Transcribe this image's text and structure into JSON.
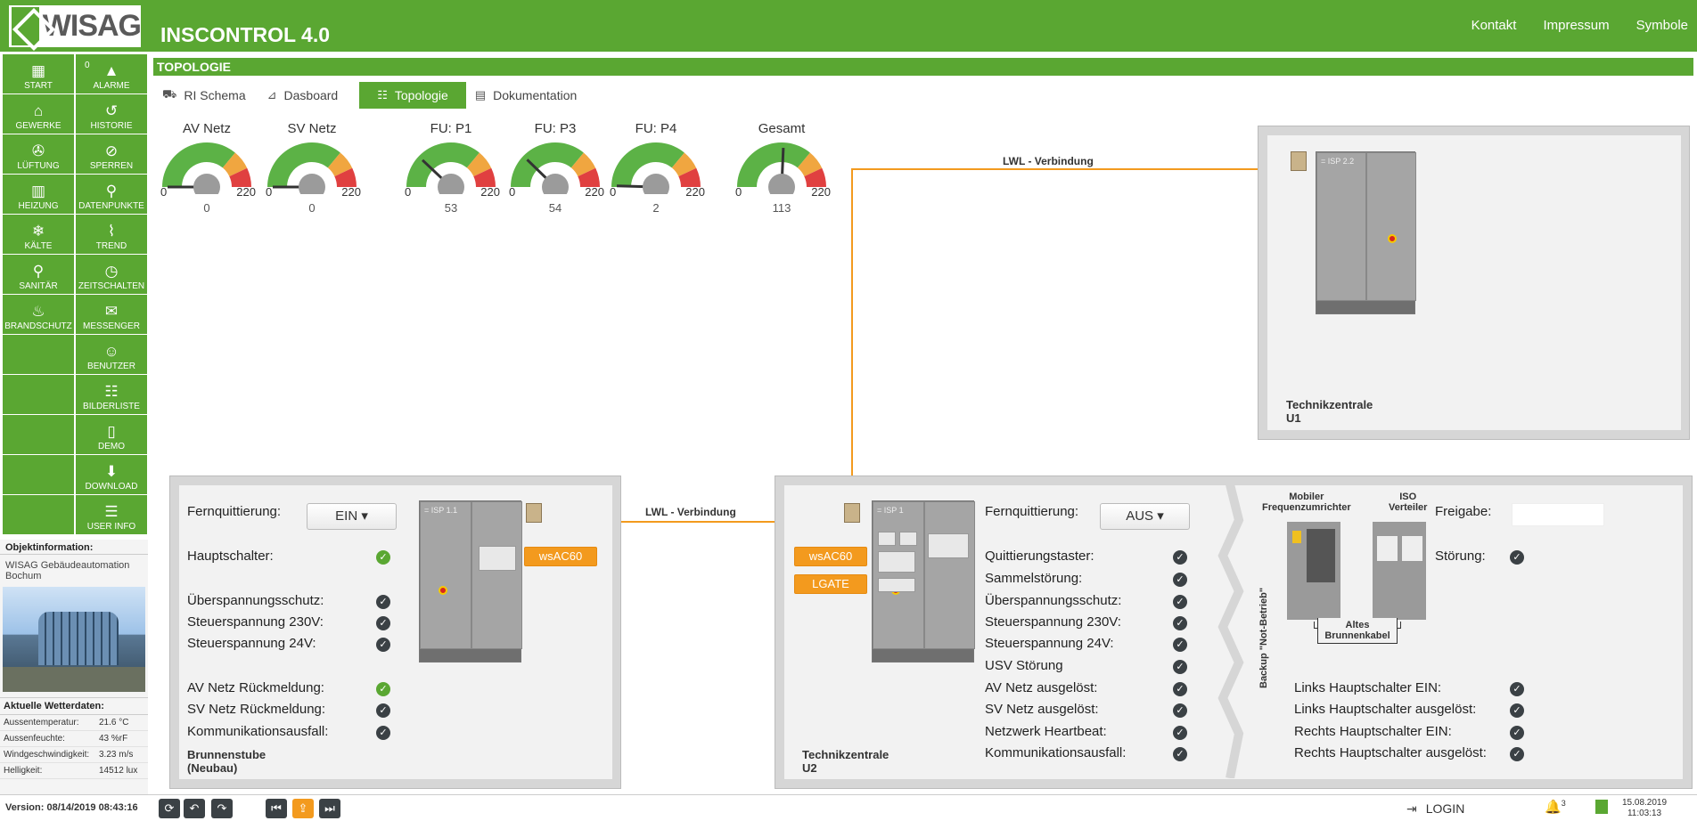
{
  "header": {
    "logo_text": "WISAG",
    "app_title": "INSCONTROL 4.0",
    "nav": [
      "Kontakt",
      "Impressum",
      "Symbole"
    ]
  },
  "sidebar": {
    "left": [
      {
        "label": "START",
        "icon": "grid-icon",
        "glyph": "▦"
      },
      {
        "label": "GEWERKE",
        "icon": "building-icon",
        "glyph": "⌂"
      },
      {
        "label": "LÜFTUNG",
        "icon": "fan-icon",
        "glyph": "✇"
      },
      {
        "label": "HEIZUNG",
        "icon": "radiator-icon",
        "glyph": "▥"
      },
      {
        "label": "KÄLTE",
        "icon": "snowflake-icon",
        "glyph": "❄"
      },
      {
        "label": "SANITÄR",
        "icon": "faucet-icon",
        "glyph": "⚲"
      },
      {
        "label": "BRANDSCHUTZ",
        "icon": "flame-icon",
        "glyph": "♨"
      }
    ],
    "right": [
      {
        "label": "ALARME",
        "icon": "alarm-icon",
        "glyph": "▲",
        "badge": "0"
      },
      {
        "label": "HISTORIE",
        "icon": "history-icon",
        "glyph": "↺"
      },
      {
        "label": "SPERREN",
        "icon": "bell-off-icon",
        "glyph": "⊘"
      },
      {
        "label": "DATENPUNKTE",
        "icon": "datapoints-icon",
        "glyph": "⚲"
      },
      {
        "label": "TREND",
        "icon": "trend-icon",
        "glyph": "⌇"
      },
      {
        "label": "ZEITSCHALTEN",
        "icon": "clock-icon",
        "glyph": "◷"
      },
      {
        "label": "MESSENGER",
        "icon": "chat-icon",
        "glyph": "✉"
      },
      {
        "label": "BENUTZER",
        "icon": "users-icon",
        "glyph": "☺"
      },
      {
        "label": "BILDERLISTE",
        "icon": "sitemap-icon",
        "glyph": "☷"
      },
      {
        "label": "DEMO",
        "icon": "door-icon",
        "glyph": "▯"
      },
      {
        "label": "DOWNLOAD",
        "icon": "download-icon",
        "glyph": "⬇"
      },
      {
        "label": "USER INFO",
        "icon": "user-info-icon",
        "glyph": "☰"
      }
    ]
  },
  "objinfo": {
    "title": "Objektinformation:",
    "text": "WISAG Gebäudeautomation Bochum"
  },
  "weather": {
    "title": "Aktuelle Wetterdaten:",
    "rows": [
      {
        "k": "Aussentemperatur:",
        "v": "21.6 °C"
      },
      {
        "k": "Aussenfeuchte:",
        "v": "43 %rF"
      },
      {
        "k": "Windgeschwindigkeit:",
        "v": "3.23 m/s"
      },
      {
        "k": "Helligkeit:",
        "v": "14512 lux"
      }
    ]
  },
  "page_title": "TOPOLOGIE",
  "tabs": [
    {
      "label": "RI Schema",
      "icon": "pump-icon",
      "glyph": "⛟",
      "active": false
    },
    {
      "label": "Dasboard",
      "icon": "chart-icon",
      "glyph": "⊿",
      "active": false
    },
    {
      "label": "Topologie",
      "icon": "topology-icon",
      "glyph": "☷",
      "active": true
    },
    {
      "label": "Dokumentation",
      "icon": "book-icon",
      "glyph": "▤",
      "active": false
    }
  ],
  "gauges": [
    {
      "label": "AV Netz",
      "min": "0",
      "max": "220",
      "value": 0
    },
    {
      "label": "SV Netz",
      "min": "0",
      "max": "220",
      "value": 0
    },
    {
      "label": "FU: P1",
      "min": "0",
      "max": "220",
      "value": 53
    },
    {
      "label": "FU: P3",
      "min": "0",
      "max": "220",
      "value": 54
    },
    {
      "label": "FU: P4",
      "min": "0",
      "max": "220",
      "value": 2
    },
    {
      "label": "Gesamt",
      "min": "0",
      "max": "220",
      "value": 113
    }
  ],
  "links": {
    "top": "LWL - Verbindung",
    "bottom": "LWL - Verbindung"
  },
  "u1": {
    "title": "Technikzentrale\nU1",
    "tag": "= ISP 2.2"
  },
  "brunnen": {
    "title": "Brunnenstube\n(Neubau)",
    "tag": "= ISP 1.1",
    "ferni_label": "Fernquittierung:",
    "ferni_value": "EIN ▾",
    "btn": "wsAC60",
    "rows": [
      {
        "label": "Hauptschalter:",
        "state": "ok"
      },
      {
        "label": "Überspannungsschutz:",
        "state": "dark"
      },
      {
        "label": "Steuerspannung 230V:",
        "state": "dark"
      },
      {
        "label": "Steuerspannung 24V:",
        "state": "dark"
      },
      {
        "label": "AV Netz Rückmeldung:",
        "state": "ok"
      },
      {
        "label": "SV Netz Rückmeldung:",
        "state": "dark"
      },
      {
        "label": "Kommunikationsausfall:",
        "state": "dark"
      }
    ]
  },
  "u2": {
    "title": "Technikzentrale\nU2",
    "tag": "= ISP 1",
    "ferni_label": "Fernquittierung:",
    "ferni_value": "AUS ▾",
    "btn1": "wsAC60",
    "btn2": "LGATE",
    "rows": [
      "Quittierungstaster:",
      "Sammelstörung:",
      "Überspannungsschutz:",
      "Steuerspannung 230V:",
      "Steuerspannung 24V:",
      "USV Störung",
      "AV Netz ausgelöst:",
      "SV Netz ausgelöst:",
      "Netzwerk Heartbeat:",
      "Kommunikationsausfall:"
    ],
    "backup": "Backup \"Not-Betrieb\"",
    "mobile": "Mobiler\nFrequenzumrichter",
    "iso": "ISO\nVerteiler",
    "cable": "Altes\nBrunnenkabel",
    "freigabe": "Freigabe:",
    "stoerung": "Störung:",
    "right_rows": [
      "Links Hauptschalter EIN:",
      "Links Hauptschalter ausgelöst:",
      "Rechts Hauptschalter EIN:",
      "Rechts Hauptschalter ausgelöst:"
    ]
  },
  "footer": {
    "version": "Version: 08/14/2019 08:43:16",
    "login": "LOGIN",
    "alarm_count": "3",
    "date": "15.08.2019",
    "time": "11:03:13"
  },
  "colors": {
    "brand": "#5aa732",
    "accent": "#f39a1e",
    "dark": "#3b4145",
    "alarm": "#d8261f"
  }
}
